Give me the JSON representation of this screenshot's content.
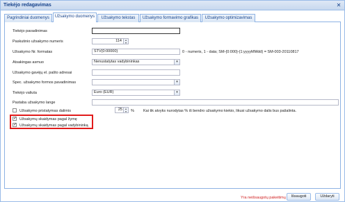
{
  "window": {
    "title": "Tiekėjo redagavimas",
    "close": "✕"
  },
  "tabs": [
    {
      "label": "Pagrindiniai duomenys"
    },
    {
      "label": "Užsakymo duomenys"
    },
    {
      "label": "Užsakymo tekstas"
    },
    {
      "label": "Užsakymo formavimo grafikas"
    },
    {
      "label": "Užsakymo optimizavimas"
    }
  ],
  "form": {
    "supplier_name": {
      "label": "Tiekėjo pavadinimas",
      "value": ""
    },
    "last_order_no": {
      "label": "Paskutinio užsakymo numeris",
      "value": "114"
    },
    "order_format": {
      "label": "Užsakymo Nr. formatas",
      "value": "STV{0:00000}",
      "hint": "0 - numeris, 1 - data; SM-{0:000}-{1:yyyyMMdd} = SM-003-20110817"
    },
    "responsible": {
      "label": "Atsakingas asmuo",
      "value": "Nenustatytas vadybininkas"
    },
    "receiver_email": {
      "label": "Užsakymo gavėjų el. pašto adresai",
      "value": ""
    },
    "form_name": {
      "label": "Spec. užsakymo formos pavadinimas",
      "value": ""
    },
    "currency": {
      "label": "Tiekėjo valiuta",
      "value": "Euro (EUR)"
    },
    "note": {
      "label": "Pastaba užsakymo lange",
      "value": ""
    },
    "delivery_part": {
      "label": "Užsakymo pristatymas dalimis",
      "value": "25",
      "unit": "%",
      "hint": "Kai tik atvyks nurodytas % iš bendro užsakymo kiekio, likusi užsakymo dalis bus pašalinta."
    },
    "split_by_tag": {
      "label": "Užsakymų skaidymas pagal žymę",
      "checked": true
    },
    "split_by_manager": {
      "label": "Užsakymų skaidymas pagal vadybininką",
      "checked": true
    }
  },
  "footer": {
    "unsaved": "Yra neišsaugotų pakeitimų",
    "save": "Išsaugoti",
    "close": "Uždaryti"
  }
}
